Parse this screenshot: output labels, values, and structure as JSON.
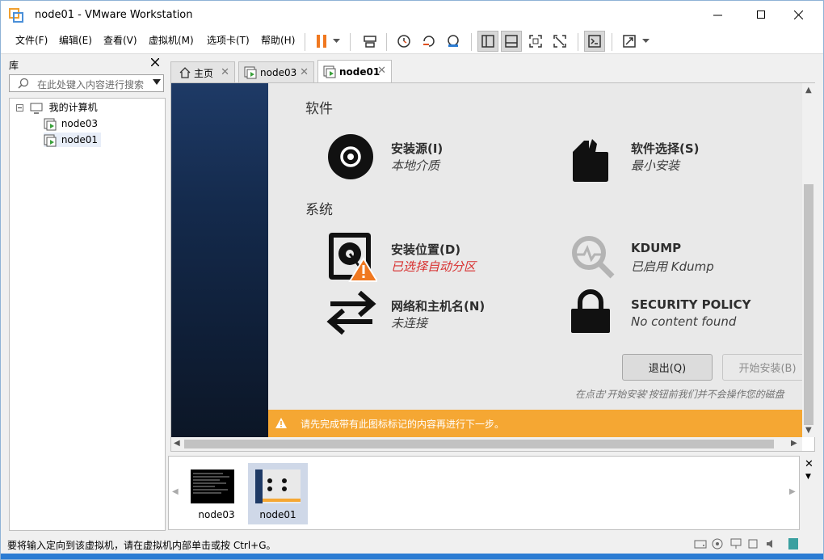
{
  "window": {
    "title": "node01 - VMware Workstation"
  },
  "menu": [
    "文件(F)",
    "编辑(E)",
    "查看(V)",
    "虚拟机(M)",
    "选项卡(T)",
    "帮助(H)"
  ],
  "library": {
    "title": "库",
    "search_placeholder": "在此处键入内容进行搜索",
    "root": "我的计算机",
    "items": [
      "node03",
      "node01"
    ]
  },
  "tabs": [
    {
      "label": "主页",
      "icon": "home-icon"
    },
    {
      "label": "node03",
      "icon": "vm-icon"
    },
    {
      "label": "node01",
      "icon": "vm-icon",
      "active": true
    }
  ],
  "installer": {
    "section_software": "软件",
    "section_system": "系统",
    "spokes": {
      "source": {
        "title": "安装源(I)",
        "subtitle": "本地介质"
      },
      "software": {
        "title": "软件选择(S)",
        "subtitle": "最小安装"
      },
      "destination": {
        "title": "安装位置(D)",
        "subtitle": "已选择自动分区"
      },
      "kdump": {
        "title": "KDUMP",
        "subtitle": "已启用 Kdump"
      },
      "network": {
        "title": "网络和主机名(N)",
        "subtitle": "未连接"
      },
      "security": {
        "title": "SECURITY POLICY",
        "subtitle": "No content found"
      }
    },
    "quit_button": "退出(Q)",
    "begin_button": "开始安装(B)",
    "note": "在点击'开始安装'按钮前我们并不会操作您的磁盘",
    "warning": "请先完成带有此图标标记的内容再进行下一步。",
    "colors": {
      "warning_bar": "#f5a733",
      "warning_text": "#d8302f"
    }
  },
  "thumbnails": [
    "node03",
    "node01"
  ],
  "status": {
    "text": "要将输入定向到该虚拟机，请在虚拟机内部单击或按 Ctrl+G。"
  }
}
